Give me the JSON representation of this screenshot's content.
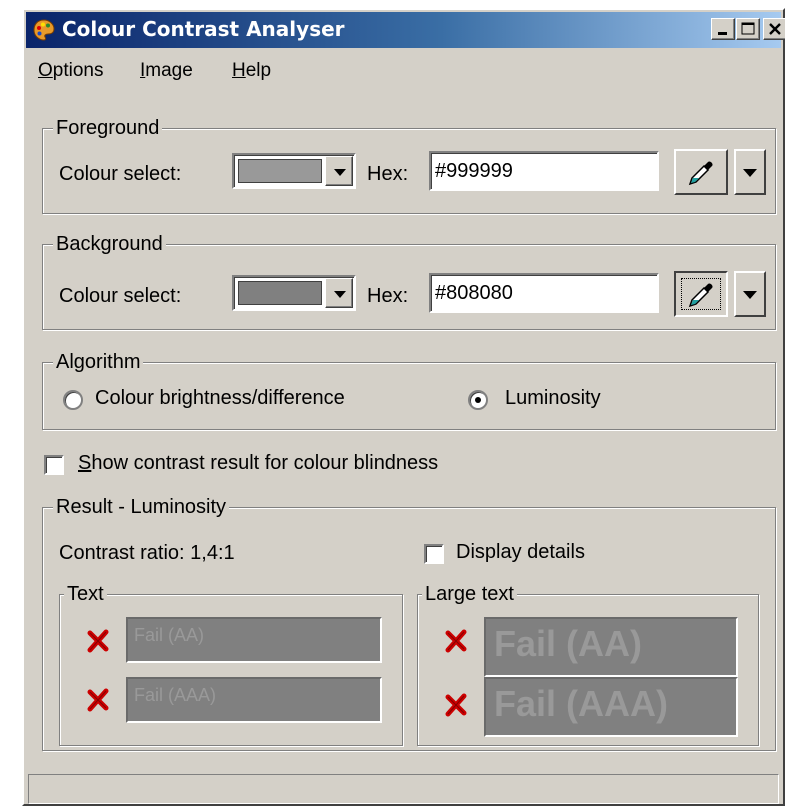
{
  "window": {
    "title": "Colour Contrast Analyser",
    "app_icon": "palette-icon"
  },
  "title_buttons": {
    "minimize_icon": "minimize-icon",
    "maximize_icon": "maximize-icon",
    "close_icon": "close-icon"
  },
  "menu": {
    "items": [
      {
        "label": "Options",
        "mnemonic": "O",
        "rest": "ptions"
      },
      {
        "label": "Image",
        "mnemonic": "I",
        "rest": "mage"
      },
      {
        "label": "Help",
        "mnemonic": "H",
        "rest": "elp"
      }
    ]
  },
  "foreground": {
    "group_label": "Foreground",
    "colour_select_label": "Colour select:",
    "swatch_color": "#999999",
    "hex_label": "Hex:",
    "hex_value": "#999999",
    "picker_icon": "eyedropper-icon"
  },
  "background": {
    "group_label": "Background",
    "colour_select_label": "Colour select:",
    "swatch_color": "#808080",
    "hex_label": "Hex:",
    "hex_value": "#808080",
    "picker_icon": "eyedropper-icon"
  },
  "algorithm": {
    "group_label": "Algorithm",
    "options": [
      {
        "label": "Colour brightness/difference",
        "selected": false
      },
      {
        "label": "Luminosity",
        "selected": true
      }
    ]
  },
  "colour_blindness": {
    "label": "Show contrast result for colour blindness",
    "mnemonic": "S",
    "rest": "how contrast result for colour blindness",
    "checked": false
  },
  "result": {
    "group_label": "Result - Luminosity",
    "contrast_ratio": "Contrast ratio: 1,4:1",
    "display_details_label": "Display details",
    "display_details_checked": false,
    "text_group": {
      "label": "Text",
      "rows": [
        {
          "status_icon": "fail-x-icon",
          "value": "Fail (AA)"
        },
        {
          "status_icon": "fail-x-icon",
          "value": "Fail (AAA)"
        }
      ]
    },
    "large_text_group": {
      "label": "Large text",
      "rows": [
        {
          "status_icon": "fail-x-icon",
          "value": "Fail (AA)"
        },
        {
          "status_icon": "fail-x-icon",
          "value": "Fail (AAA)"
        }
      ]
    },
    "fail_colors": {
      "mark": "#cc0000",
      "field_bg": "#808080",
      "field_text": "#999999"
    }
  },
  "status_bar": {
    "text": ""
  }
}
